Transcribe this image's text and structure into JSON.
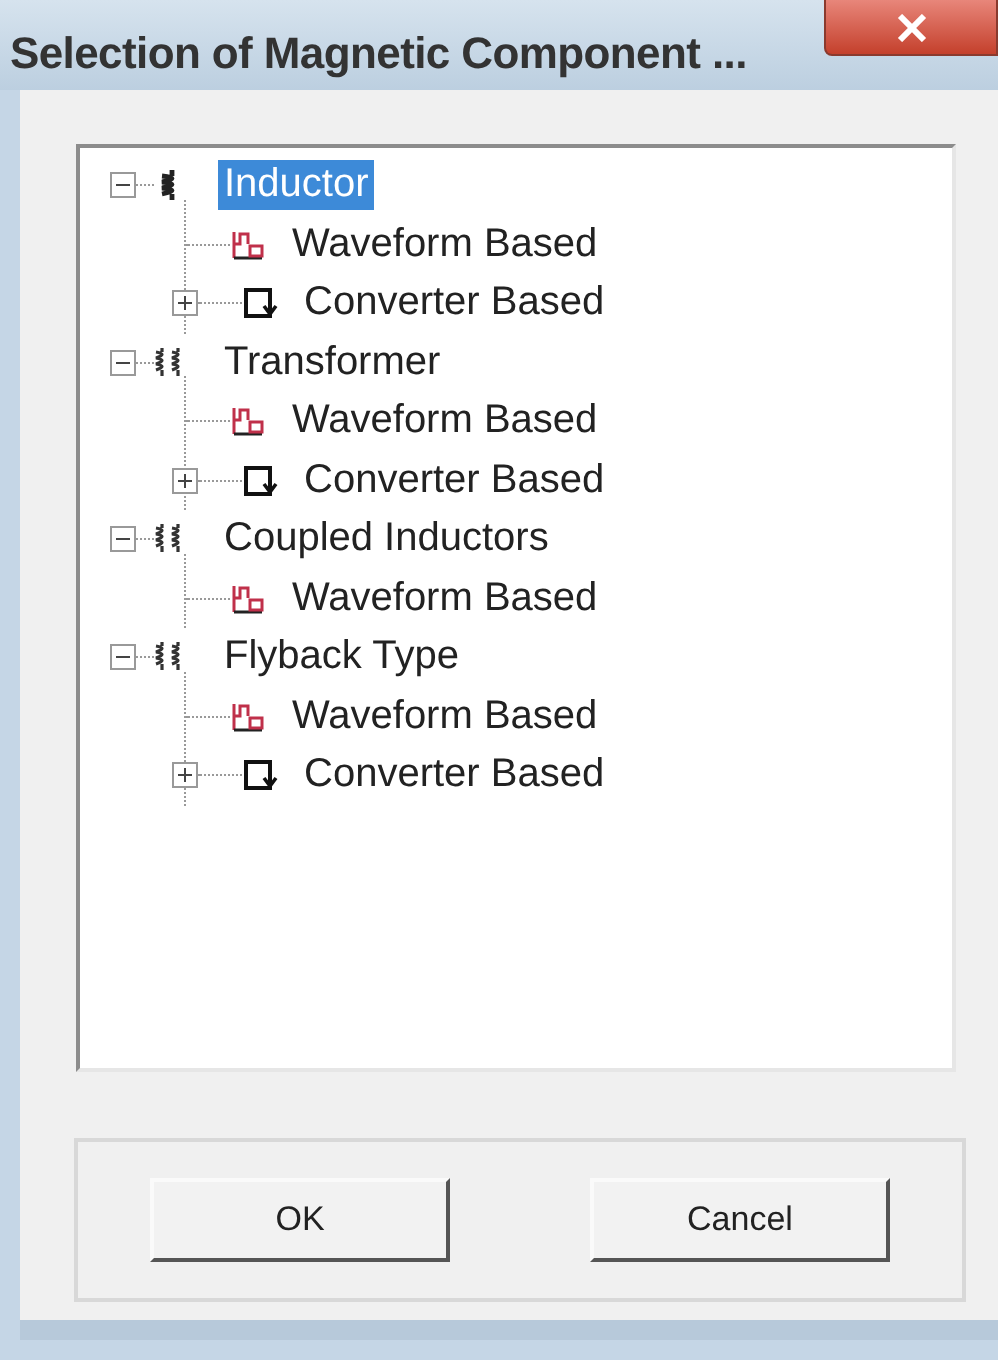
{
  "window": {
    "title": "Selection of Magnetic Component ..."
  },
  "tree": [
    {
      "label": "Inductor",
      "kind": "inductor",
      "expanded": true,
      "selected": true,
      "children": [
        {
          "label": "Waveform Based",
          "kind": "waveform",
          "selected": false
        },
        {
          "label": "Converter Based",
          "kind": "converter",
          "expanded": false,
          "selected": false
        }
      ]
    },
    {
      "label": "Transformer",
      "kind": "transformer",
      "expanded": true,
      "selected": false,
      "children": [
        {
          "label": "Waveform Based",
          "kind": "waveform",
          "selected": false
        },
        {
          "label": "Converter Based",
          "kind": "converter",
          "expanded": false,
          "selected": false
        }
      ]
    },
    {
      "label": "Coupled Inductors",
      "kind": "transformer",
      "expanded": true,
      "selected": false,
      "children": [
        {
          "label": "Waveform Based",
          "kind": "waveform",
          "selected": false
        }
      ]
    },
    {
      "label": "Flyback Type",
      "kind": "transformer",
      "expanded": true,
      "selected": false,
      "children": [
        {
          "label": "Waveform Based",
          "kind": "waveform",
          "selected": false
        },
        {
          "label": "Converter Based",
          "kind": "converter",
          "expanded": false,
          "selected": false
        }
      ]
    }
  ],
  "buttons": [
    "OK",
    "Cancel"
  ]
}
